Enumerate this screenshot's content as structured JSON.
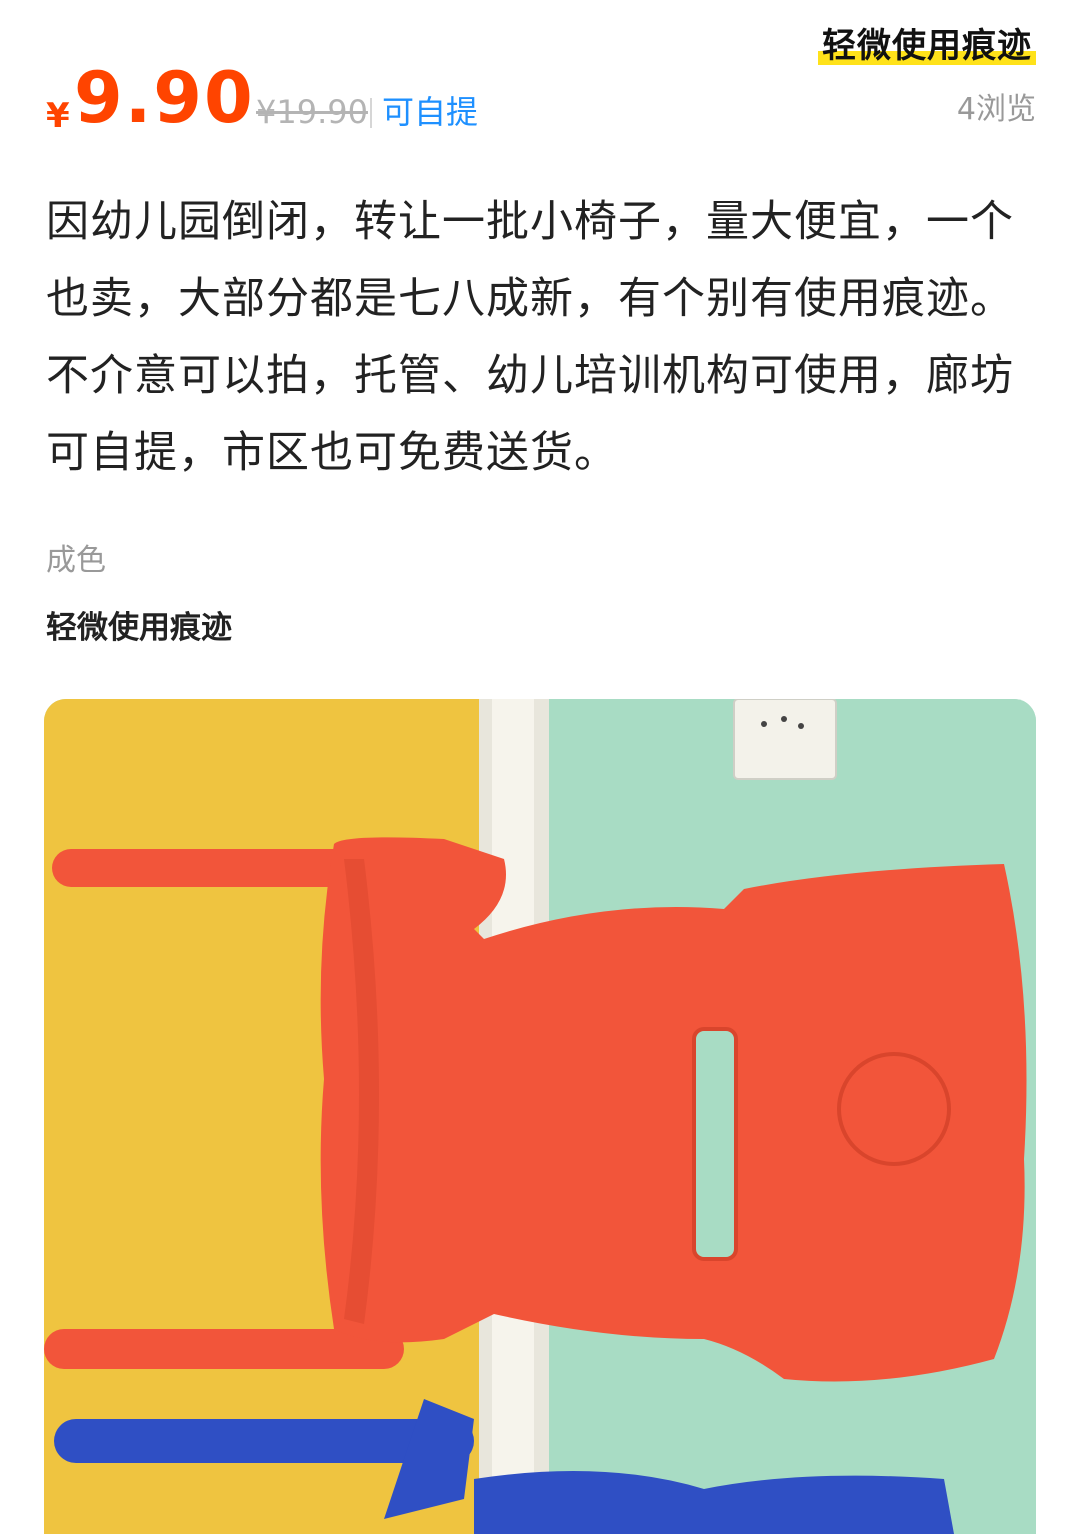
{
  "condition_badge": "轻微使用痕迹",
  "price": {
    "currency": "¥",
    "current": "9.90",
    "original": "¥19.90",
    "pickup": "可自提"
  },
  "views": "4浏览",
  "description": "因幼儿园倒闭，转让一批小椅子，量大便宜，一个也卖，大部分都是七八成新，有个别有使用痕迹。不介意可以拍，托管、幼儿培训机构可使用，廊坊可自提，市区也可免费送货。",
  "condition": {
    "label": "成色",
    "value": "轻微使用痕迹"
  },
  "colors": {
    "price": "#ff4400",
    "pickup": "#1e90ff",
    "badge_highlight": "#ffe21a",
    "chair_red": "#f2553a",
    "chair_blue": "#2f4fc4",
    "wall_yellow": "#efc440",
    "wall_green": "#a8dcc4"
  }
}
